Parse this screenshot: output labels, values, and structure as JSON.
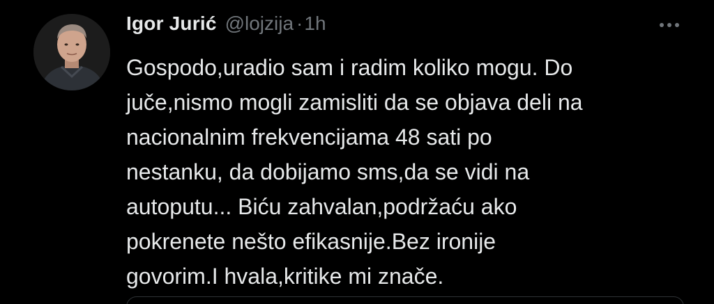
{
  "tweet": {
    "author_name": "Igor Jurić",
    "author_handle": "@lojzija",
    "separator": "·",
    "time": "1h",
    "lines": [
      "Gospodo,uradio sam i radim koliko mogu. Do",
      "juče,nismo mogli zamisliti da se objava deli na",
      "nacionalnim frekvencijama 48 sati po",
      "nestanku, da dobijamo sms,da se vidi na",
      "autoputu... Biću zahvalan,podržaću ako",
      "pokrenete nešto efikasnije.Bez ironije",
      "govorim.I hvala,kritike mi znače."
    ]
  },
  "icons": {
    "more": "more-options-icon",
    "avatar": "avatar"
  },
  "colors": {
    "background": "#000000",
    "text_primary": "#e7e9ea",
    "text_secondary": "#71767b",
    "border": "#2f3336"
  }
}
